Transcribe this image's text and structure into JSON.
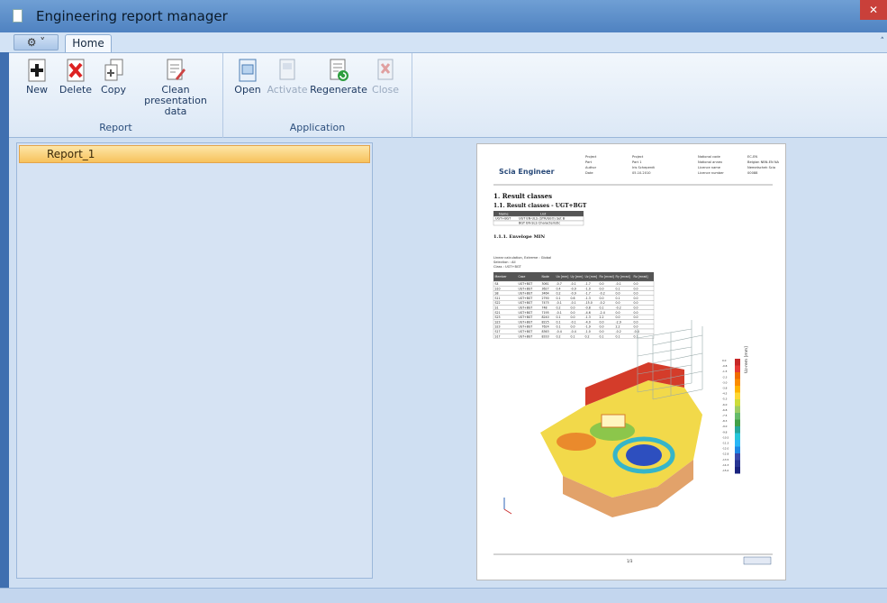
{
  "window": {
    "title": "Engineering report manager",
    "close_glyph": "✕"
  },
  "ribbon": {
    "app_menu_glyph": "⚙ ˅",
    "tabs": [
      {
        "label": "Home"
      }
    ],
    "collapse_glyph": "˄",
    "groups": {
      "report": {
        "label": "Report",
        "buttons": {
          "new": "New",
          "delete": "Delete",
          "copy": "Copy",
          "clean": "Clean presentation data"
        }
      },
      "application": {
        "label": "Application",
        "buttons": {
          "open": "Open",
          "activate": "Activate",
          "regenerate": "Regenerate",
          "close": "Close"
        }
      }
    }
  },
  "reports": [
    {
      "name": "Report_1",
      "selected": true
    }
  ],
  "preview": {
    "logo": "Scia Engineer",
    "header_fields": [
      [
        "Project",
        "Project"
      ],
      [
        "Part",
        "Part 1"
      ],
      [
        "Author",
        "Iris Scheperdt"
      ],
      [
        "Date",
        "05.10.2010"
      ]
    ],
    "header_right": [
      [
        "National code",
        "EC-EN"
      ],
      [
        "National annex",
        "Belgian NBN-EN NA"
      ],
      [
        "Licence name",
        "Nemetschek Scia"
      ],
      [
        "Licence number",
        "00088"
      ]
    ],
    "heading1": "1. Result classes",
    "heading2": "1.1. Result classes - UGT+BGT",
    "class_table": {
      "headers": [
        "Name",
        "List"
      ],
      "rows": [
        [
          "UGT+BGT",
          "UGT  EN-ULS (STR/GEO) Set B"
        ],
        [
          "",
          "BGT  EN-SLS Characteristic"
        ]
      ]
    },
    "heading3": "1.1.1. Envelope MIN",
    "notes": [
      "Linear calculation, Extreme : Global",
      "Selection : All",
      "Class : UGT+BGT"
    ],
    "results_table": {
      "headers": [
        "Member",
        "Case",
        "Node",
        "Ux [mm]",
        "Uy [mm]",
        "Uz [mm]",
        "Fix [mrad]",
        "Fiy [mrad]",
        "Fiz [mrad]"
      ],
      "rows": [
        [
          "S4",
          "UGT+BGT",
          "3061",
          "-0.7",
          "-0.1",
          "-1.7",
          "0.0",
          "-0.1",
          "0.0"
        ],
        [
          "S10",
          "UGT+BGT",
          "3627",
          "0.4",
          "-0.9",
          "-1.0",
          "0.0",
          "0.1",
          "0.0"
        ],
        [
          "S8",
          "UGT+BGT",
          "3464",
          "0.2",
          "-0.9",
          "-1.7",
          "-0.2",
          "0.0",
          "0.0"
        ],
        [
          "S11",
          "UGT+BGT",
          "2790",
          "0.1",
          "0.6",
          "-1.3",
          "0.0",
          "0.1",
          "0.0"
        ],
        [
          "S22",
          "UGT+BGT",
          "7475",
          "-0.1",
          "-0.1",
          "-15.0",
          "-0.2",
          "0.0",
          "0.0"
        ],
        [
          "S1",
          "UGT+BGT",
          "748",
          "0.2",
          "0.0",
          "-0.8",
          "0.1",
          "-0.2",
          "0.0"
        ],
        [
          "S21",
          "UGT+BGT",
          "7195",
          "-0.1",
          "0.0",
          "-4.6",
          "-2.4",
          "0.0",
          "0.0"
        ],
        [
          "S23",
          "UGT+BGT",
          "8240",
          "0.1",
          "0.0",
          "-1.3",
          "2.2",
          "0.0",
          "0.0"
        ],
        [
          "S23",
          "UGT+BGT",
          "8225",
          "0.1",
          "-0.1",
          "-4.0",
          "0.0",
          "-2.9",
          "0.0"
        ],
        [
          "S23",
          "UGT+BGT",
          "7624",
          "0.1",
          "0.0",
          "-1.9",
          "0.0",
          "2.2",
          "0.0"
        ],
        [
          "S17",
          "UGT+BGT",
          "8363",
          "-0.4",
          "-0.4",
          "-1.0",
          "0.0",
          "-0.2",
          "-0.4"
        ],
        [
          "S17",
          "UGT+BGT",
          "8333",
          "0.2",
          "0.1",
          "0.2",
          "0.1",
          "0.1",
          "0.1"
        ]
      ]
    },
    "legend_title": "Uz-rem [mm]",
    "legend_values": [
      "0.0",
      "-0.8",
      "-1.5",
      "-2.3",
      "-3.0",
      "-3.8",
      "-4.5",
      "-5.3",
      "-6.0",
      "-6.8",
      "-7.5",
      "-8.3",
      "-9.0",
      "-9.8",
      "-10.5",
      "-11.3",
      "-12.0",
      "-12.8",
      "-13.5",
      "-14.3",
      "-15.0"
    ],
    "footer_page": "1/3",
    "colors": {
      "accent": "#4f82c1",
      "selection": "#f7c25c"
    }
  }
}
